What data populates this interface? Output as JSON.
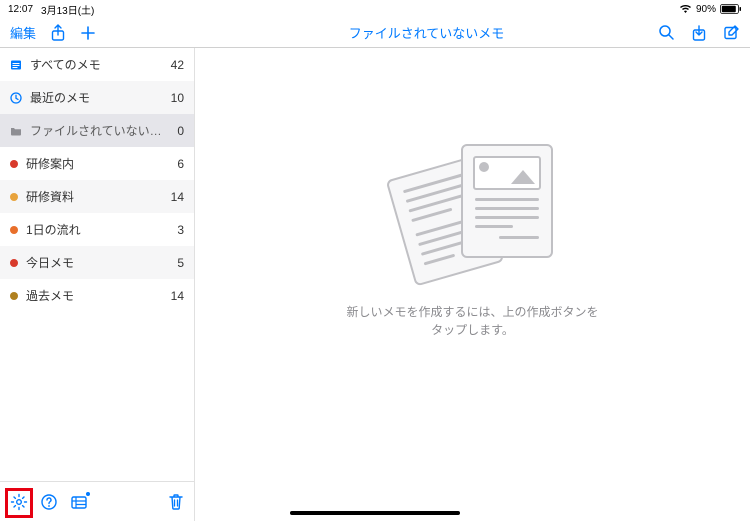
{
  "status": {
    "time": "12:07",
    "date": "3月13日(土)",
    "battery_pct": "90%"
  },
  "toolbar": {
    "edit_label": "編集",
    "title": "ファイルされていないメモ"
  },
  "sidebar": {
    "items": [
      {
        "kind": "all",
        "label": "すべてのメモ",
        "count": "42",
        "selected": false,
        "color": "#007aff"
      },
      {
        "kind": "recent",
        "label": "最近のメモ",
        "count": "10",
        "selected": false,
        "color": "#007aff"
      },
      {
        "kind": "unfiled",
        "label": "ファイルされていないメモ",
        "count": "0",
        "selected": true,
        "color": "#8e8e93"
      },
      {
        "kind": "folder",
        "label": "研修案内",
        "count": "6",
        "selected": false,
        "color": "#d83a2b"
      },
      {
        "kind": "folder",
        "label": "研修資料",
        "count": "14",
        "selected": false,
        "color": "#e8a33d"
      },
      {
        "kind": "folder",
        "label": "1日の流れ",
        "count": "3",
        "selected": false,
        "color": "#e86f2b"
      },
      {
        "kind": "folder",
        "label": "今日メモ",
        "count": "5",
        "selected": false,
        "color": "#d83a2b"
      },
      {
        "kind": "folder",
        "label": "過去メモ",
        "count": "14",
        "selected": false,
        "color": "#b0801f"
      }
    ]
  },
  "empty_state": {
    "text": "新しいメモを作成するには、上の作成ボタンをタップします。"
  },
  "icons": {
    "share": "share-icon",
    "add": "plus-icon",
    "search": "search-icon",
    "download": "download-icon",
    "compose": "compose-icon",
    "settings": "gear-icon",
    "help": "help-icon",
    "organizer": "organizer-icon",
    "trash": "trash-icon"
  }
}
